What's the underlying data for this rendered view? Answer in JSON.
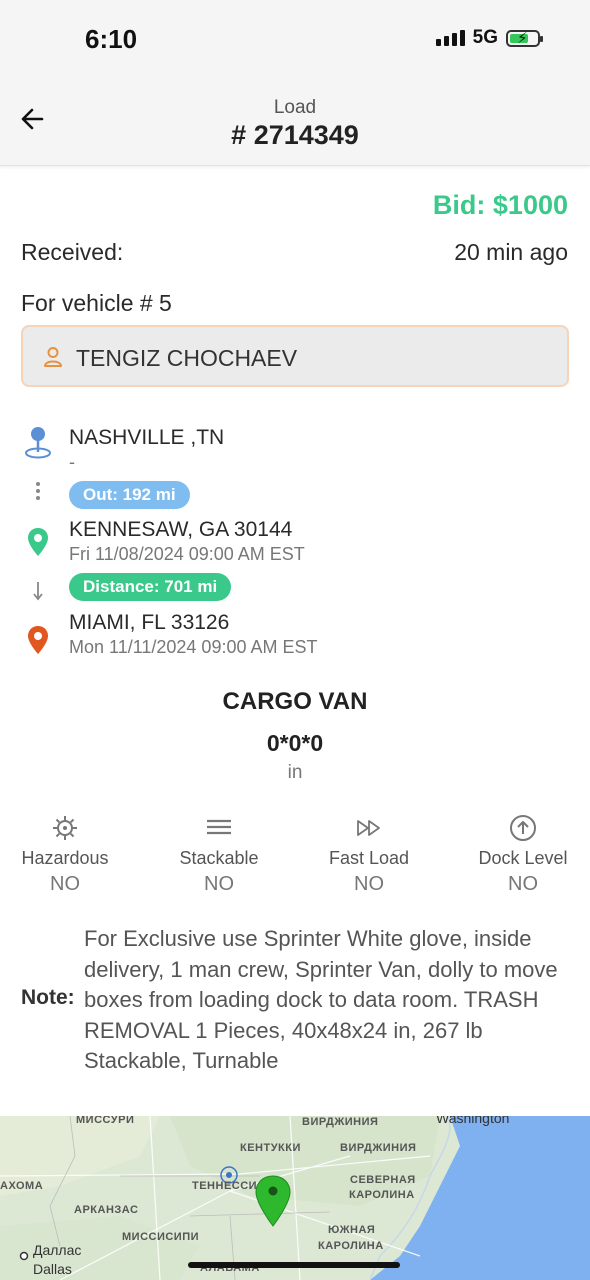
{
  "status_bar": {
    "time": "6:10",
    "network": "5G",
    "battery_level": 0.7
  },
  "header": {
    "subtitle": "Load",
    "title": "# 2714349"
  },
  "bid": "Bid: $1000",
  "received": {
    "label": "Received:",
    "value": "20 min ago"
  },
  "vehicle_label": "For vehicle # 5",
  "driver_name": "TENGIZ CHOCHAEV",
  "route": {
    "origin": {
      "title": "NASHVILLE ,TN",
      "sub": "-"
    },
    "out_pill": "Out: 192 mi",
    "pickup": {
      "title": "KENNESAW, GA 30144",
      "sub": "Fri 11/08/2024 09:00 AM EST"
    },
    "distance_pill": "Distance: 701 mi",
    "delivery": {
      "title": "MIAMI, FL 33126",
      "sub": "Mon 11/11/2024 09:00 AM EST"
    }
  },
  "cargo": {
    "type": "CARGO VAN",
    "dims": "0*0*0",
    "unit": "in"
  },
  "features": [
    {
      "label": "Hazardous",
      "value": "NO",
      "icon": "hazard-icon"
    },
    {
      "label": "Stackable",
      "value": "NO",
      "icon": "stack-icon"
    },
    {
      "label": "Fast Load",
      "value": "NO",
      "icon": "fast-forward-icon"
    },
    {
      "label": "Dock Level",
      "value": "NO",
      "icon": "arrow-up-circle-icon"
    }
  ],
  "note": {
    "label": "Note:",
    "text": "For Exclusive use Sprinter  White glove, inside delivery, 1 man crew, Sprinter Van, dolly to move boxes from loading dock to data room. TRASH REMOVAL 1 Pieces, 40x48x24 in, 267 lb Stackable, Turnable"
  },
  "map": {
    "labels": [
      "МИССУРИ",
      "ВИРДЖИНИЯ",
      "Washington",
      "КЕНТУККИ",
      "ВИРДЖИНИЯ",
      "АХОМА",
      "ТЕННЕССИ",
      "СЕВЕРНАЯ",
      "КАРОЛИНА",
      "АРКАНЗАС",
      "МИССИСИПИ",
      "ЮЖНАЯ",
      "КАРОЛИНА",
      "Даллас",
      "Dallas",
      "АЛАБАМА"
    ]
  },
  "colors": {
    "accent_green": "#3ac98a",
    "out_pill": "#7fbdf0",
    "driver_border": "#f7d4b8",
    "pickup_pin": "#3ac98a",
    "delivery_pin": "#e2561f",
    "origin_pin": "#5b8fd6"
  }
}
